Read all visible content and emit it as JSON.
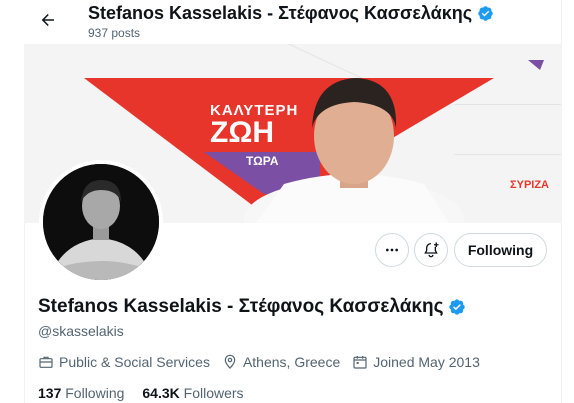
{
  "header": {
    "title": "Stefanos Kasselakis - Στέφανος Κασσελάκης",
    "posts": "937 posts"
  },
  "banner": {
    "slogan_line1": "ΚΑΛΥΤΕΡΗ",
    "slogan_line2": "ΖΩΗ",
    "slogan_line3": "ΤΩΡΑ",
    "party": "ΣΥΡΙΖΑ",
    "colors": {
      "red": "#e8352c",
      "purple": "#7b4fa3",
      "background": "#f4f4f4"
    }
  },
  "actions": {
    "more_icon": "more-dots-icon",
    "notify_icon": "bell-plus-icon",
    "follow_label": "Following"
  },
  "profile": {
    "name": "Stefanos Kasselakis - Στέφανος Κασσελάκης",
    "handle": "@skasselakis",
    "verified_color": "#1d9bf0",
    "category": "Public & Social Services",
    "location": "Athens, Greece",
    "joined": "Joined May 2013"
  },
  "stats": {
    "following_count": "137",
    "following_label": "Following",
    "followers_count": "64.3K",
    "followers_label": "Followers"
  }
}
